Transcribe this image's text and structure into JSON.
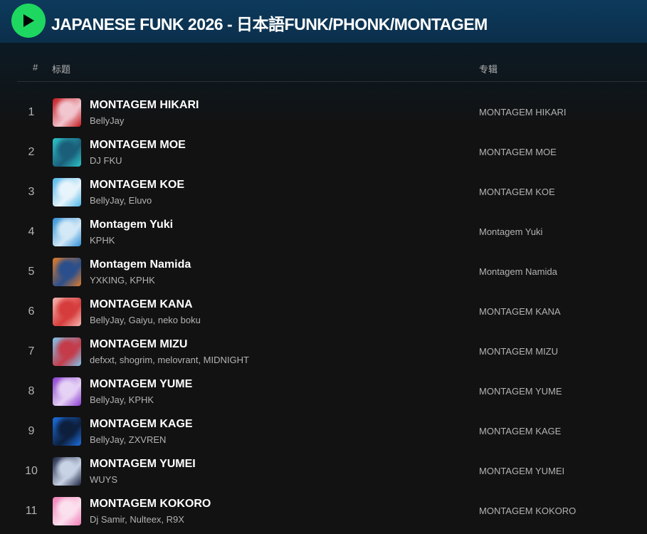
{
  "playlist": {
    "title": "JAPANESE FUNK 2026 - 日本語FUNK/PHONK/MONTAGEM",
    "play_icon": "play-icon",
    "accent_color": "#1ed760"
  },
  "table": {
    "col_number": "#",
    "col_title": "标题",
    "col_album": "专辑"
  },
  "tracks": [
    {
      "number": "1",
      "name": "MONTAGEM HIKARI",
      "artists": "BellyJay",
      "album": "MONTAGEM HIKARI",
      "cover_colors": [
        "#c4161c",
        "#f2c6cf"
      ]
    },
    {
      "number": "2",
      "name": "MONTAGEM MOE",
      "artists": "DJ FKU",
      "album": "MONTAGEM MOE",
      "cover_colors": [
        "#2cc4c8",
        "#1b5e7a"
      ]
    },
    {
      "number": "3",
      "name": "MONTAGEM KOE",
      "artists": "BellyJay, Eluvo",
      "album": "MONTAGEM KOE",
      "cover_colors": [
        "#4fb7e8",
        "#e8f4fb"
      ]
    },
    {
      "number": "4",
      "name": "Montagem Yuki",
      "artists": "KPHK",
      "album": "Montagem Yuki",
      "cover_colors": [
        "#2f8fd6",
        "#d3e9f7"
      ]
    },
    {
      "number": "5",
      "name": "Montagem Namida",
      "artists": "YXKING, KPHK",
      "album": "Montagem Namida",
      "cover_colors": [
        "#e07b2a",
        "#2a4f8c"
      ]
    },
    {
      "number": "6",
      "name": "MONTAGEM KANA",
      "artists": "BellyJay, Gaiyu, neko boku",
      "album": "MONTAGEM KANA",
      "cover_colors": [
        "#f5b7b1",
        "#d63c3c"
      ]
    },
    {
      "number": "7",
      "name": "MONTAGEM MIZU",
      "artists": "defxxt, shogrim, melovrant, MIDNIGHT",
      "album": "MONTAGEM MIZU",
      "cover_colors": [
        "#7fc6ee",
        "#c43c4a"
      ]
    },
    {
      "number": "8",
      "name": "MONTAGEM YUME",
      "artists": "BellyJay, KPHK",
      "album": "MONTAGEM YUME",
      "cover_colors": [
        "#8a3ccf",
        "#e6d2f5"
      ]
    },
    {
      "number": "9",
      "name": "MONTAGEM KAGE",
      "artists": "BellyJay, ZXVREN",
      "album": "MONTAGEM KAGE",
      "cover_colors": [
        "#1d6fe0",
        "#0d1f3d"
      ]
    },
    {
      "number": "10",
      "name": "MONTAGEM YUMEI",
      "artists": "WUYS",
      "album": "MONTAGEM YUMEI",
      "cover_colors": [
        "#1a2340",
        "#c9d3e6"
      ]
    },
    {
      "number": "11",
      "name": "MONTAGEM KOKORO",
      "artists": "Dj Samir, Nulteex, R9X",
      "album": "MONTAGEM KOKORO",
      "cover_colors": [
        "#f07bb5",
        "#fbe0ee"
      ]
    }
  ]
}
